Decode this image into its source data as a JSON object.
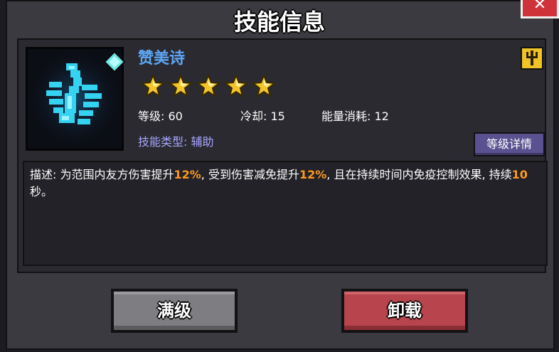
{
  "window": {
    "title": "技能信息",
    "close_icon": "close-icon"
  },
  "skill": {
    "name": "赞美诗",
    "stars": 5,
    "stats": {
      "level": "等级: 60",
      "cooldown": "冷却: 15",
      "energy": "能量消耗: 12"
    },
    "type_label": "技能类型: ",
    "type_value": "辅助",
    "detail_button": "等级详情",
    "description": {
      "p1": "描述: 为范围内友方伤害提升",
      "v1": "12%",
      "p2": ", 受到伤害减免提升",
      "v2": "12%",
      "p3": ", 且在持续时间内免疫控制效果, 持续",
      "v3": "10",
      "p4": "秒。"
    }
  },
  "buttons": {
    "max_level": "满级",
    "unload": "卸载"
  },
  "colors": {
    "skill_name": "#5ea6f5",
    "highlight": "#ff9a1e",
    "star": "#f2c62a",
    "detail_button": "#5a5290",
    "max_button": "#7e7e82",
    "unload_button": "#b8454d"
  }
}
